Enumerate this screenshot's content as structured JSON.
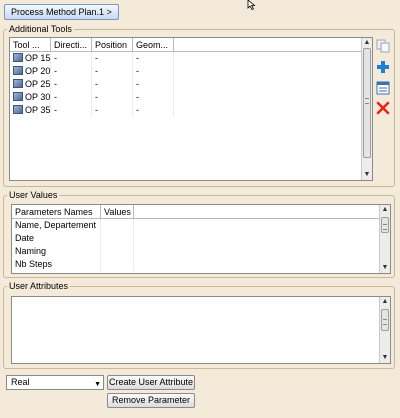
{
  "breadcrumb": "Process Method Plan.1 >",
  "additional_tools": {
    "legend": "Additional Tools",
    "columns": [
      "Tool ...",
      "Directi...",
      "Position",
      "Geom..."
    ],
    "rows": [
      {
        "tool": "OP 15",
        "direction": "-",
        "position": "-",
        "geom": "-"
      },
      {
        "tool": "OP 20",
        "direction": "-",
        "position": "-",
        "geom": "-"
      },
      {
        "tool": "OP 25",
        "direction": "-",
        "position": "-",
        "geom": "-"
      },
      {
        "tool": "OP 30",
        "direction": "-",
        "position": "-",
        "geom": "-"
      },
      {
        "tool": "OP 35",
        "direction": "-",
        "position": "-",
        "geom": "-"
      }
    ],
    "side_icons": [
      "copy-icon",
      "add-icon",
      "list-icon",
      "delete-icon"
    ],
    "colors": {
      "add": "#1f7fd6",
      "delete": "#e8261c"
    }
  },
  "user_values": {
    "legend": "User Values",
    "columns": [
      "Parameters Names",
      "Values"
    ],
    "rows": [
      {
        "name": "Name, Departement",
        "value": ""
      },
      {
        "name": "Date",
        "value": ""
      },
      {
        "name": "Naming",
        "value": ""
      },
      {
        "name": "Nb Steps",
        "value": ""
      }
    ]
  },
  "user_attributes": {
    "legend": "User Attributes"
  },
  "type_combo": {
    "value": "Real"
  },
  "buttons": {
    "create_attribute": "Create User Attribute",
    "remove_parameter": "Remove Parameter"
  }
}
